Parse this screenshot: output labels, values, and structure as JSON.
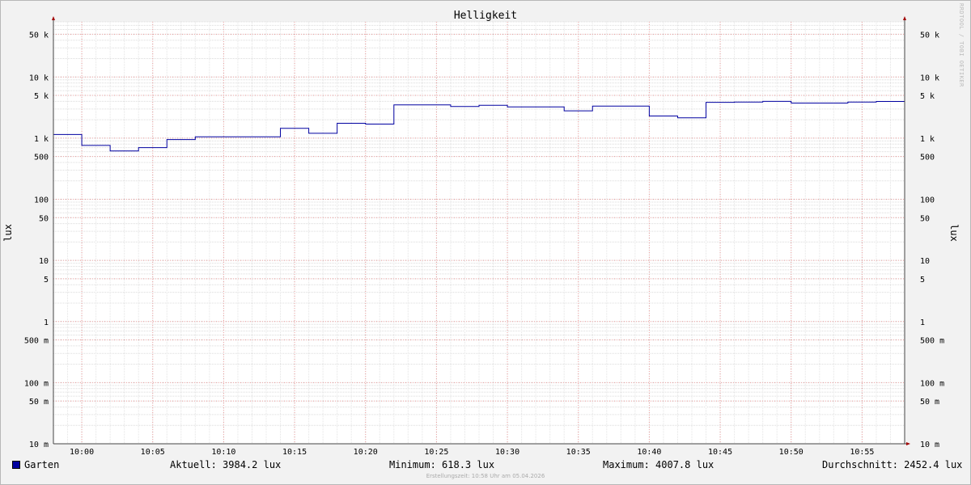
{
  "chart_data": {
    "type": "line",
    "title": "Helligkeit",
    "ylabel": "lux",
    "y_scale": "log",
    "ylim": [
      0.01,
      80000
    ],
    "y_ticks": [
      {
        "value": 0.01,
        "label": "10 m"
      },
      {
        "value": 0.05,
        "label": "50 m"
      },
      {
        "value": 0.1,
        "label": "100 m"
      },
      {
        "value": 0.5,
        "label": "500 m"
      },
      {
        "value": 1,
        "label": "1"
      },
      {
        "value": 5,
        "label": "5"
      },
      {
        "value": 10,
        "label": "10"
      },
      {
        "value": 50,
        "label": "50"
      },
      {
        "value": 100,
        "label": "100"
      },
      {
        "value": 500,
        "label": "500"
      },
      {
        "value": 1000,
        "label": "1 k"
      },
      {
        "value": 5000,
        "label": "5 k"
      },
      {
        "value": 10000,
        "label": "10 k"
      },
      {
        "value": 50000,
        "label": "50 k"
      }
    ],
    "x_start": "09:58",
    "x_end": "10:58",
    "x_ticks": [
      "10:00",
      "10:05",
      "10:10",
      "10:15",
      "10:20",
      "10:25",
      "10:30",
      "10:35",
      "10:40",
      "10:45",
      "10:50",
      "10:55"
    ],
    "grid": true,
    "series": [
      {
        "name": "Garten",
        "color": "#0000a0",
        "step": true,
        "x": [
          "09:58",
          "10:00",
          "10:02",
          "10:04",
          "10:06",
          "10:08",
          "10:10",
          "10:12",
          "10:14",
          "10:16",
          "10:18",
          "10:20",
          "10:22",
          "10:24",
          "10:26",
          "10:28",
          "10:30",
          "10:32",
          "10:34",
          "10:36",
          "10:38",
          "10:40",
          "10:42",
          "10:44",
          "10:46",
          "10:48",
          "10:50",
          "10:52",
          "10:54",
          "10:56",
          "10:58"
        ],
        "values": [
          1150,
          760,
          618.3,
          700,
          950,
          1050,
          1050,
          1050,
          1450,
          1200,
          1750,
          1700,
          3500,
          3500,
          3300,
          3450,
          3250,
          3250,
          2800,
          3350,
          3350,
          2300,
          2150,
          3850,
          3900,
          4007.8,
          3750,
          3750,
          3900,
          3984.2,
          3984.2
        ]
      }
    ]
  },
  "legend": {
    "series_name": "Garten",
    "aktuell": "Aktuell: 3984.2 lux",
    "minimum": "Minimum: 618.3 lux",
    "maximum": "Maximum: 4007.8 lux",
    "durchschnitt": "Durchschnitt: 2452.4 lux"
  },
  "footer": "Erstellungszeit: 10:58 Uhr am 05.04.2026",
  "watermark": "RRDTOOL / TOBI OETIKER"
}
